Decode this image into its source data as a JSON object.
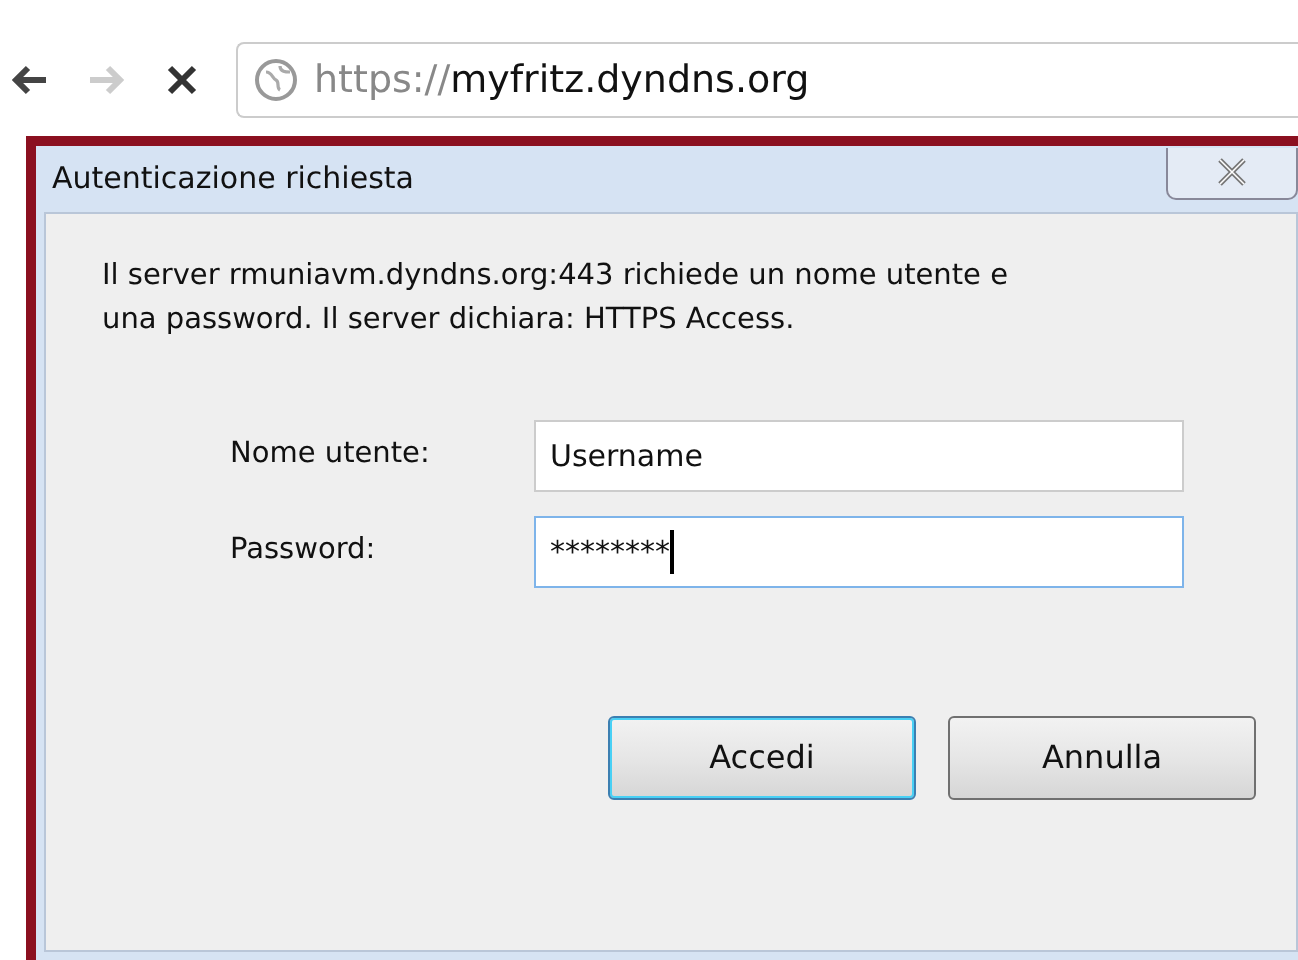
{
  "browser": {
    "url_scheme": "https://",
    "url_host": "myfritz.dyndns.org"
  },
  "dialog": {
    "title": "Autenticazione richiesta",
    "message": "Il server rmuniavm.dyndns.org:443 richiede un nome utente e una password. Il server dichiara: HTTPS Access.",
    "fields": [
      {
        "label": "Nome utente:",
        "value": "Username",
        "focused": false
      },
      {
        "label": "Password:",
        "value": "********",
        "focused": true
      }
    ],
    "buttons": [
      {
        "label": "Accedi",
        "default": true
      },
      {
        "label": "Annulla",
        "default": false
      }
    ]
  }
}
